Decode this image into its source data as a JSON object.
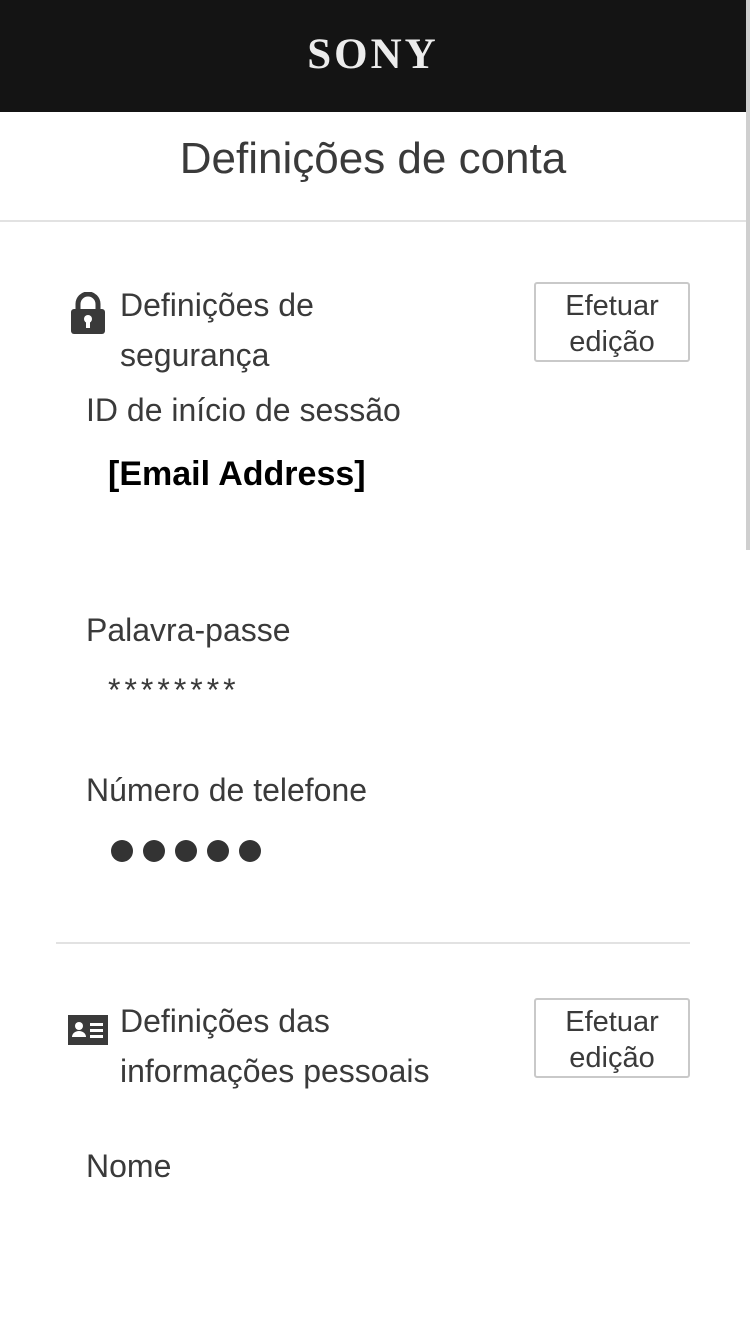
{
  "header": {
    "logo_text": "SONY",
    "background_color": "#141414"
  },
  "page": {
    "title": "Definições de conta"
  },
  "security": {
    "icon": "lock-icon",
    "title_line1": "Definições de",
    "title_line2": "segurança",
    "edit_line1": "Efetuar",
    "edit_line2": "edição",
    "fields": [
      {
        "label": "ID de início de sessão",
        "value": "[Email Address]"
      },
      {
        "label": "Palavra-passe",
        "value": "********"
      },
      {
        "label": "Número de telefone",
        "value": "●●●●●"
      }
    ]
  },
  "personal": {
    "icon": "id-card-icon",
    "title_line1": "Definições das",
    "title_line2": "informações pessoais",
    "edit_line1": "Efetuar",
    "edit_line2": "edição",
    "fields": [
      {
        "label": "Nome"
      }
    ]
  }
}
